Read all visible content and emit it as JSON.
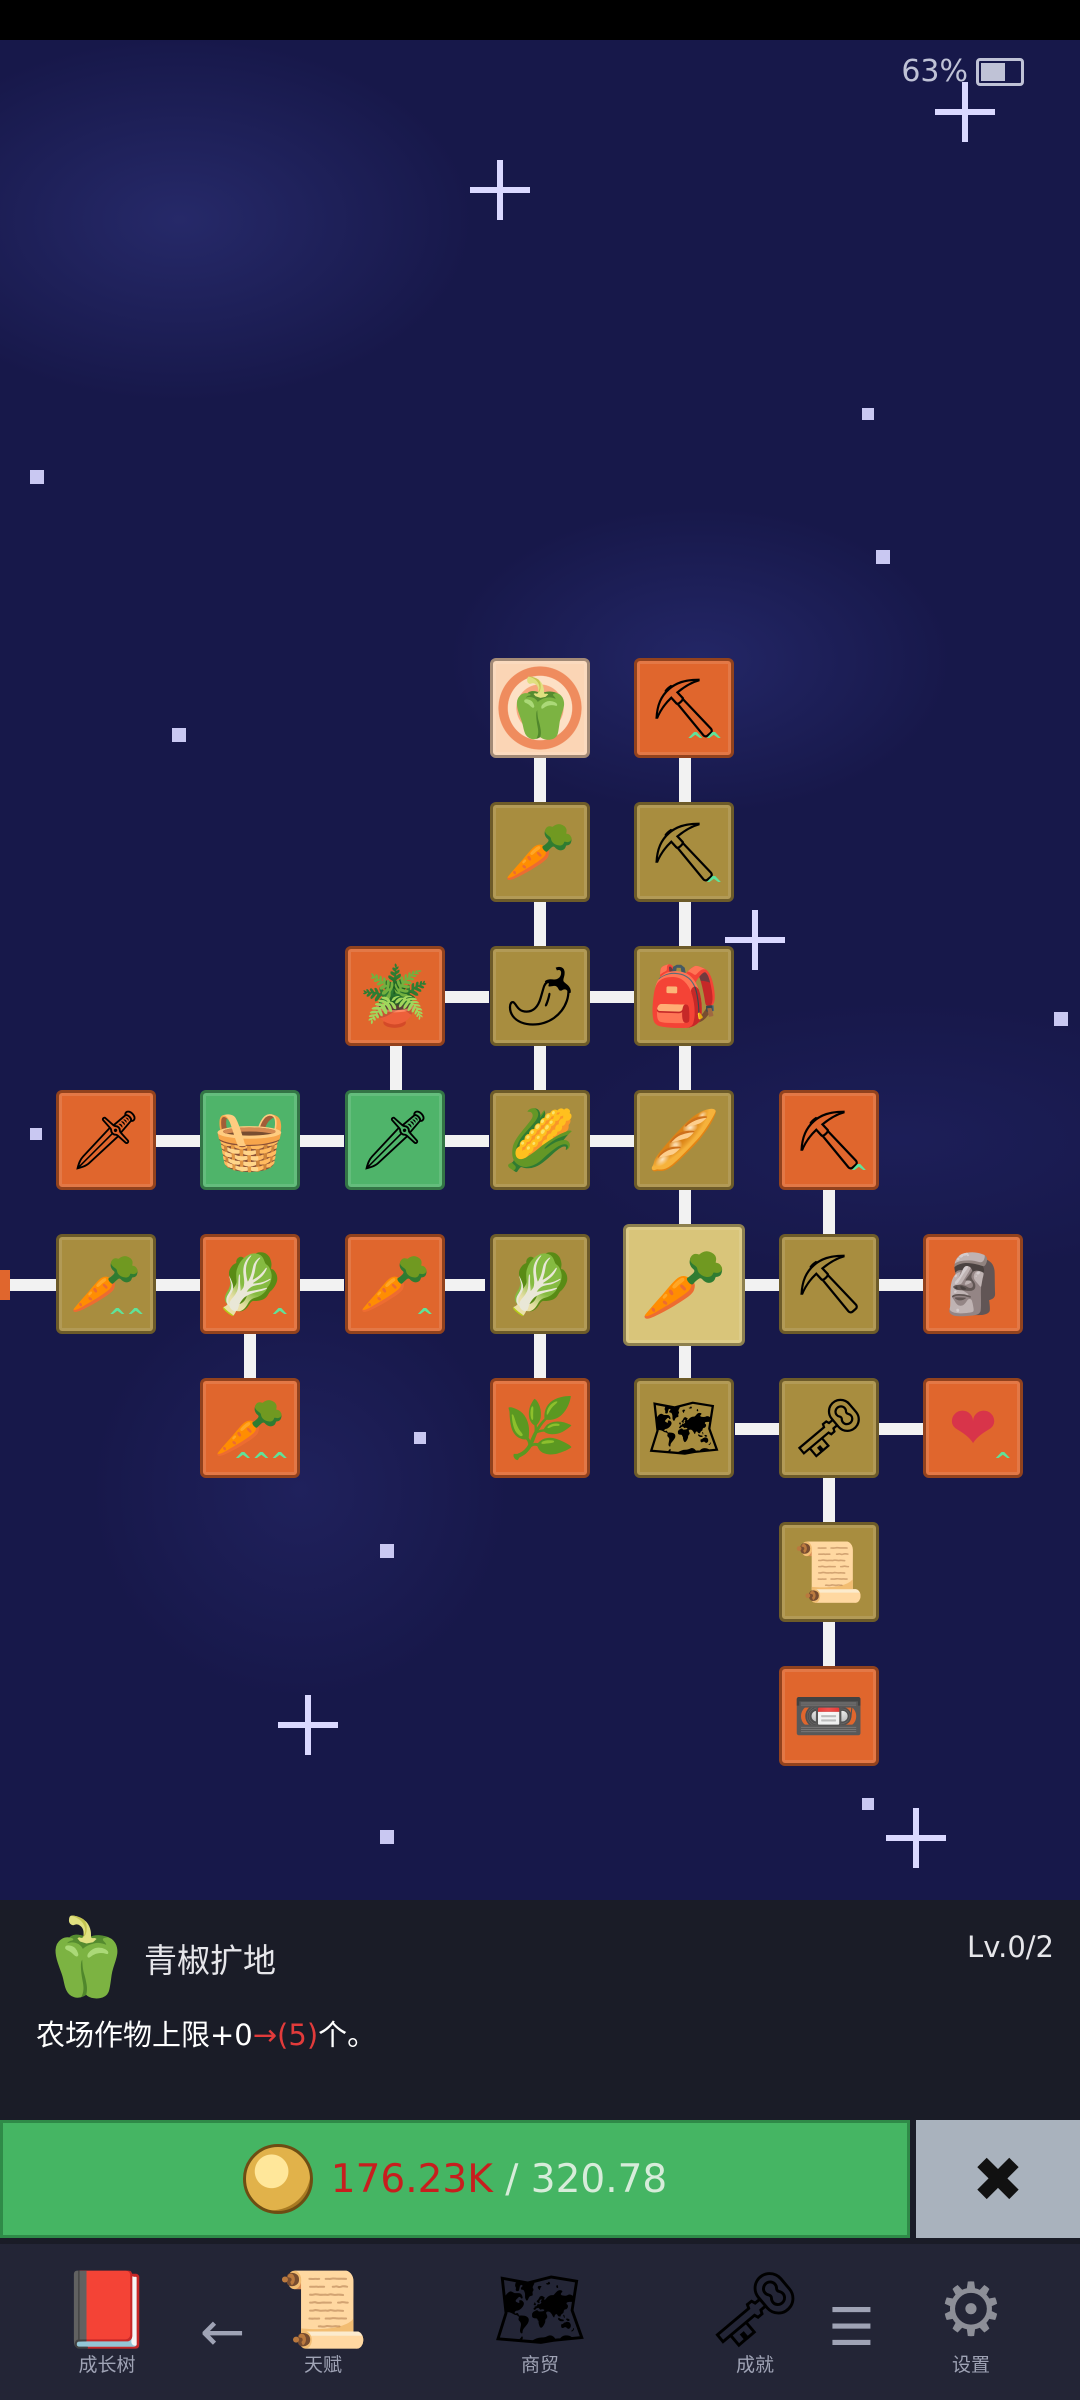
{
  "status": {
    "battery": "63%"
  },
  "tree": {
    "nodes": [
      {
        "id": "green-pepper",
        "icon": "🫑",
        "icon_name": "green-pepper-icon",
        "color": "glow",
        "upgrade": ""
      },
      {
        "id": "shovel-a",
        "icon": "⛏",
        "icon_name": "shovel-icon",
        "color": "orange",
        "upgrade": "^^"
      },
      {
        "id": "radish",
        "icon": "🥕",
        "icon_name": "white-radish-icon",
        "color": "gold",
        "upgrade": ""
      },
      {
        "id": "shovel-b",
        "icon": "⛏",
        "icon_name": "shovel-icon",
        "color": "gold",
        "upgrade": "^"
      },
      {
        "id": "pot",
        "icon": "🪴",
        "icon_name": "clay-pot-icon",
        "color": "orange",
        "upgrade": ""
      },
      {
        "id": "chili",
        "icon": "🌶",
        "icon_name": "chili-pepper-icon",
        "color": "gold",
        "upgrade": ""
      },
      {
        "id": "backpack",
        "icon": "🎒",
        "icon_name": "backpack-icon",
        "color": "gold",
        "upgrade": ""
      },
      {
        "id": "sword-a",
        "icon": "🗡",
        "icon_name": "sword-icon",
        "color": "orange",
        "upgrade": ""
      },
      {
        "id": "crate",
        "icon": "🧺",
        "icon_name": "crate-icon",
        "color": "green",
        "upgrade": ""
      },
      {
        "id": "sword-b",
        "icon": "🗡",
        "icon_name": "sword-icon",
        "color": "green",
        "upgrade": ""
      },
      {
        "id": "corn",
        "icon": "🌽",
        "icon_name": "corn-icon",
        "color": "gold",
        "upgrade": ""
      },
      {
        "id": "stick",
        "icon": "🥖",
        "icon_name": "wooden-stick-icon",
        "color": "gold",
        "upgrade": ""
      },
      {
        "id": "pickaxe-a",
        "icon": "⛏",
        "icon_name": "pickaxe-icon",
        "color": "orange",
        "upgrade": "^"
      },
      {
        "id": "carrot-a",
        "icon": "🥕",
        "icon_name": "carrot-icon",
        "color": "gold",
        "upgrade": "^^"
      },
      {
        "id": "cabbage-a",
        "icon": "🥬",
        "icon_name": "cabbage-icon",
        "color": "orange",
        "upgrade": "^"
      },
      {
        "id": "carrot-b",
        "icon": "🥕",
        "icon_name": "carrot-icon",
        "color": "orange",
        "upgrade": "^"
      },
      {
        "id": "cabbage-b",
        "icon": "🥬",
        "icon_name": "cabbage-icon",
        "color": "gold",
        "upgrade": ""
      },
      {
        "id": "carrot-center",
        "icon": "🥕",
        "icon_name": "carrot-icon",
        "color": "big",
        "upgrade": ""
      },
      {
        "id": "pickaxe-b",
        "icon": "⛏",
        "icon_name": "pickaxe-icon",
        "color": "gold",
        "upgrade": ""
      },
      {
        "id": "statue",
        "icon": "🗿",
        "icon_name": "stone-statue-icon",
        "color": "orange",
        "upgrade": ""
      },
      {
        "id": "carrot-c",
        "icon": "🥕",
        "icon_name": "carrot-icon",
        "color": "orange",
        "upgrade": "^^^"
      },
      {
        "id": "leek",
        "icon": "🌿",
        "icon_name": "leek-icon",
        "color": "orange",
        "upgrade": ""
      },
      {
        "id": "map",
        "icon": "🗺",
        "icon_name": "map-icon",
        "color": "gold",
        "upgrade": ""
      },
      {
        "id": "key",
        "icon": "🗝",
        "icon_name": "golden-key-icon",
        "color": "gold",
        "upgrade": ""
      },
      {
        "id": "heart",
        "icon": "❤",
        "icon_name": "heart-icon",
        "color": "orange",
        "upgrade": "^"
      },
      {
        "id": "scroll",
        "icon": "📜",
        "icon_name": "scroll-icon",
        "color": "gold",
        "upgrade": ""
      },
      {
        "id": "cassette",
        "icon": "📼",
        "icon_name": "cassette-icon",
        "color": "orange",
        "upgrade": ""
      }
    ]
  },
  "info": {
    "icon": "🫑",
    "title": "青椒扩地",
    "level": "Lv.0/2",
    "desc_prefix": "农场作物上限+0",
    "desc_arrow": "→(5)",
    "desc_suffix": "个。"
  },
  "buy": {
    "current": "176.23K",
    "separator": " / ",
    "cost": "320.78"
  },
  "close": {
    "label": "✖"
  },
  "nav": {
    "items": [
      {
        "icon": "📕",
        "label": "成长树"
      },
      {
        "icon": "📜",
        "label": "天赋"
      },
      {
        "icon": "🗺",
        "label": "商贸"
      },
      {
        "icon": "🗝",
        "label": "成就"
      },
      {
        "icon": "⚙",
        "label": "设置"
      }
    ],
    "back_icon": "←",
    "menu_icon": "☰"
  }
}
